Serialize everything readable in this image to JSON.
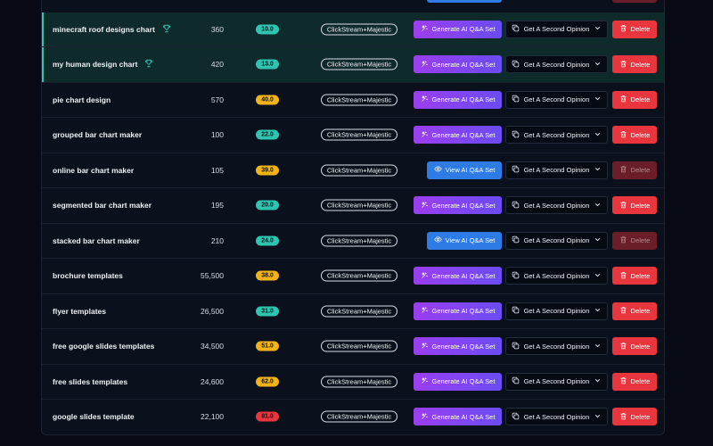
{
  "colors": {
    "score_teal": "#2ec4b0",
    "score_yellow": "#f2b318",
    "score_red": "#e8353e",
    "generate_gradient_start": "#9b3ef0",
    "generate_gradient_end": "#6a4cf3",
    "view_blue": "#2f7be6",
    "delete_red": "#e8353e"
  },
  "icons": {
    "trophy": "trophy-icon",
    "generate": "sparkle-icon",
    "view": "eye-icon",
    "opinion": "copy-icon",
    "dropdown": "chevron-down-icon",
    "delete": "trash-icon"
  },
  "labels": {
    "generate": "Generate AI Q&A Set",
    "view": "View AI Q&A Set",
    "opinion": "Get A Second Opinion",
    "delete": "Delete"
  },
  "rows": [
    {
      "keyword": "minecraft roof designs chart",
      "trophy": true,
      "volume": "360",
      "score": "10.0",
      "score_color": "teal",
      "source": "ClickStream+Majestic",
      "action": "generate",
      "delete_enabled": true,
      "highlighted": true
    },
    {
      "keyword": "my human design chart",
      "trophy": true,
      "volume": "420",
      "score": "13.0",
      "score_color": "teal",
      "source": "ClickStream+Majestic",
      "action": "generate",
      "delete_enabled": true,
      "highlighted": true
    },
    {
      "keyword": "pie chart design",
      "trophy": false,
      "volume": "570",
      "score": "40.0",
      "score_color": "yellow",
      "source": "ClickStream+Majestic",
      "action": "generate",
      "delete_enabled": true,
      "highlighted": false
    },
    {
      "keyword": "grouped bar chart maker",
      "trophy": false,
      "volume": "100",
      "score": "22.0",
      "score_color": "teal",
      "source": "ClickStream+Majestic",
      "action": "generate",
      "delete_enabled": true,
      "highlighted": false
    },
    {
      "keyword": "online bar chart maker",
      "trophy": false,
      "volume": "105",
      "score": "39.0",
      "score_color": "yellow",
      "source": "ClickStream+Majestic",
      "action": "view",
      "delete_enabled": false,
      "highlighted": false
    },
    {
      "keyword": "segmented bar chart maker",
      "trophy": false,
      "volume": "195",
      "score": "20.0",
      "score_color": "teal",
      "source": "ClickStream+Majestic",
      "action": "generate",
      "delete_enabled": true,
      "highlighted": false
    },
    {
      "keyword": "stacked bar chart maker",
      "trophy": false,
      "volume": "210",
      "score": "24.0",
      "score_color": "teal",
      "source": "ClickStream+Majestic",
      "action": "view",
      "delete_enabled": false,
      "highlighted": false
    },
    {
      "keyword": "brochure templates",
      "trophy": false,
      "volume": "55,500",
      "score": "38.0",
      "score_color": "yellow",
      "source": "ClickStream+Majestic",
      "action": "generate",
      "delete_enabled": true,
      "highlighted": false
    },
    {
      "keyword": "flyer templates",
      "trophy": false,
      "volume": "26,500",
      "score": "31.0",
      "score_color": "teal",
      "source": "ClickStream+Majestic",
      "action": "generate",
      "delete_enabled": true,
      "highlighted": false
    },
    {
      "keyword": "free google slides templates",
      "trophy": false,
      "volume": "34,500",
      "score": "51.0",
      "score_color": "yellow",
      "source": "ClickStream+Majestic",
      "action": "generate",
      "delete_enabled": true,
      "highlighted": false
    },
    {
      "keyword": "free slides templates",
      "trophy": false,
      "volume": "24,600",
      "score": "62.0",
      "score_color": "yellow",
      "source": "ClickStream+Majestic",
      "action": "generate",
      "delete_enabled": true,
      "highlighted": false
    },
    {
      "keyword": "google slides template",
      "trophy": false,
      "volume": "22,100",
      "score": "91.0",
      "score_color": "red",
      "source": "ClickStream+Majestic",
      "action": "generate",
      "delete_enabled": true,
      "highlighted": false
    }
  ]
}
